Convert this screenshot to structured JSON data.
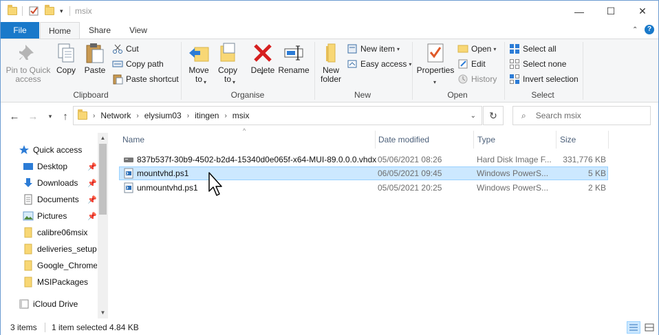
{
  "window": {
    "title": "msix",
    "controls": {
      "minimize": "—",
      "maximize": "☐",
      "close": "✕"
    }
  },
  "ribbon_tabs": [
    {
      "label": "File"
    },
    {
      "label": "Home"
    },
    {
      "label": "Share"
    },
    {
      "label": "View"
    }
  ],
  "ribbon": {
    "clipboard": {
      "label": "Clipboard",
      "pin_line1": "Pin to Quick",
      "pin_line2": "access",
      "copy": "Copy",
      "paste": "Paste",
      "cut": "Cut",
      "copy_path": "Copy path",
      "paste_shortcut": "Paste shortcut"
    },
    "organise": {
      "label": "Organise",
      "move_line1": "Move",
      "move_line2": "to",
      "copy_line1": "Copy",
      "copy_line2": "to",
      "delete": "Delete",
      "rename": "Rename"
    },
    "new": {
      "label": "New",
      "new_folder_line1": "New",
      "new_folder_line2": "folder",
      "new_item": "New item",
      "easy_access": "Easy access"
    },
    "open": {
      "label": "Open",
      "properties": "Properties",
      "open": "Open",
      "edit": "Edit",
      "history": "History"
    },
    "select": {
      "label": "Select",
      "select_all": "Select all",
      "select_none": "Select none",
      "invert": "Invert selection"
    }
  },
  "address": {
    "path": [
      "Network",
      "elysium03",
      "itingen",
      "msix"
    ],
    "search_placeholder": "Search msix"
  },
  "navpane": {
    "items": [
      {
        "label": "Quick access",
        "icon": "star-icon",
        "pinned": false
      },
      {
        "label": "Desktop",
        "icon": "desktop-icon",
        "pinned": true
      },
      {
        "label": "Downloads",
        "icon": "download-icon",
        "pinned": true
      },
      {
        "label": "Documents",
        "icon": "documents-icon",
        "pinned": true
      },
      {
        "label": "Pictures",
        "icon": "pictures-icon",
        "pinned": true
      },
      {
        "label": "calibre06msix",
        "icon": "folder-icon",
        "pinned": false
      },
      {
        "label": "deliveries_setupE",
        "icon": "folder-icon",
        "pinned": false
      },
      {
        "label": "Google_Chrome",
        "icon": "folder-icon",
        "pinned": false
      },
      {
        "label": "MSIPackages",
        "icon": "folder-icon",
        "pinned": false
      },
      {
        "label": "iCloud Drive",
        "icon": "cloud-drive-icon",
        "pinned": false
      }
    ]
  },
  "filelist": {
    "columns": {
      "name": "Name",
      "date": "Date modified",
      "type": "Type",
      "size": "Size"
    },
    "rows": [
      {
        "name": "837b537f-30b9-4502-b2d4-15340d0e065f-x64-MUI-89.0.0.0.vhdx",
        "date": "05/06/2021 08:26",
        "type": "Hard Disk Image F...",
        "size": "331,776 KB",
        "icon": "disk-image-icon",
        "selected": false
      },
      {
        "name": "mountvhd.ps1",
        "date": "06/05/2021 09:45",
        "type": "Windows PowerS...",
        "size": "5 KB",
        "icon": "powershell-file-icon",
        "selected": true
      },
      {
        "name": "unmountvhd.ps1",
        "date": "05/05/2021 20:25",
        "type": "Windows PowerS...",
        "size": "2 KB",
        "icon": "powershell-file-icon",
        "selected": false
      }
    ]
  },
  "status": {
    "items_count": "3 items",
    "selection": "1 item selected  4.84 KB"
  },
  "colors": {
    "accent": "#1979ca",
    "selection": "#cce8ff",
    "selection_border": "#99d1ff",
    "folder": "#f8d775"
  }
}
